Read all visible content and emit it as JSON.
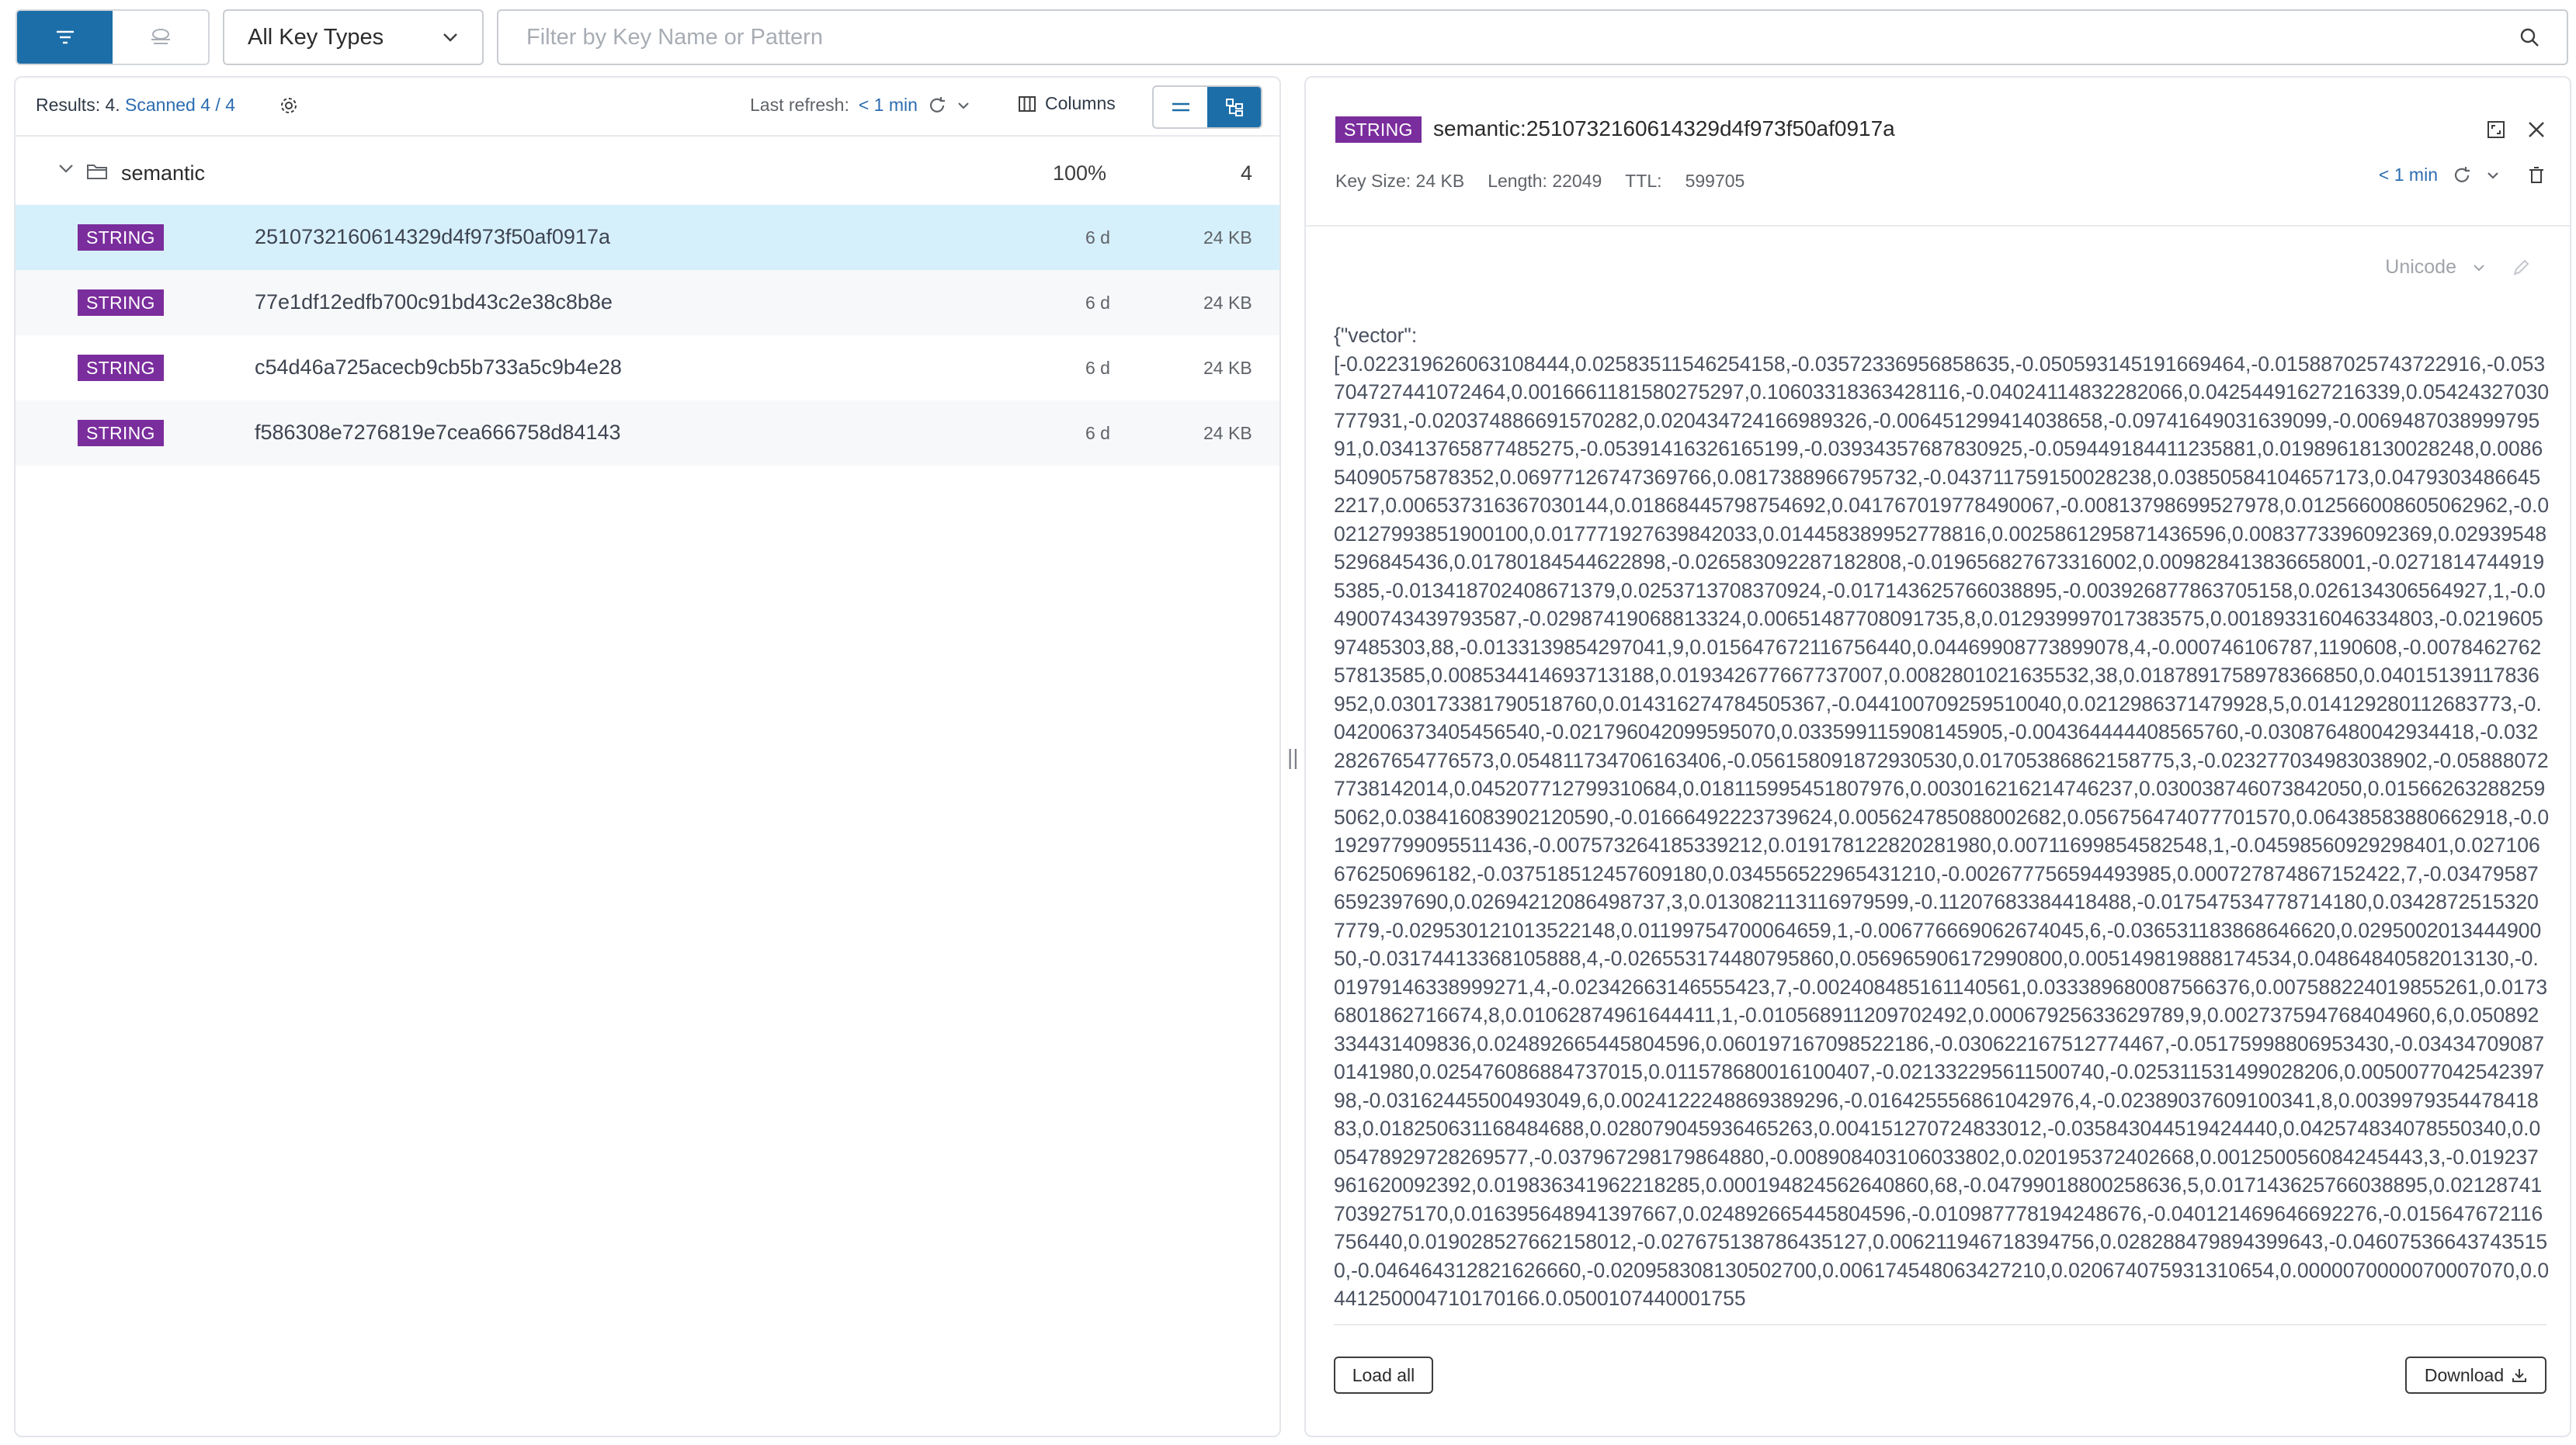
{
  "toolbar": {
    "key_type_select": "All Key Types",
    "filter_placeholder": "Filter by Key Name or Pattern"
  },
  "browser": {
    "results_label": "Results: 4.",
    "scanned_label": "Scanned 4 / 4",
    "last_refresh_label": "Last refresh:",
    "last_refresh_value": "< 1 min",
    "columns_label": "Columns"
  },
  "tree": {
    "folder": {
      "name": "semantic",
      "percent": "100%",
      "count": "4"
    },
    "keys": [
      {
        "type": "STRING",
        "name": "2510732160614329d4f973f50af0917a",
        "ttl": "6 d",
        "size": "24 KB"
      },
      {
        "type": "STRING",
        "name": "77e1df12edfb700c91bd43c2e38c8b8e",
        "ttl": "6 d",
        "size": "24 KB"
      },
      {
        "type": "STRING",
        "name": "c54d46a725acecb9cb5b733a5c9b4e28",
        "ttl": "6 d",
        "size": "24 KB"
      },
      {
        "type": "STRING",
        "name": "f586308e7276819e7cea666758d84143",
        "ttl": "6 d",
        "size": "24 KB"
      }
    ]
  },
  "details": {
    "type": "STRING",
    "key": "semantic:2510732160614329d4f973f50af0917a",
    "key_size": "Key Size: 24 KB",
    "length": "Length: 22049",
    "ttl_label": "TTL:",
    "ttl_value": "599705",
    "refresh_value": "< 1 min",
    "format": "Unicode",
    "value_header": "{\"vector\":",
    "value": "[-0.022319626063108444,0.02583511546254158,-0.03572336956858635,-0.050593145191669464,-0.015887025743722916,-0.053704727441072464,0.0016661181580275297,0.10603318363428116,-0.04024114832282066,0.04254491627216339,0.05424327030777931,-0.020374886691570282,0.020434724166989326,-0.006451299414038658,-0.09741649031639099,-0.006948703899979591,0.03413765877485275,-0.05391416326165199,-0.03934357687830925,-0.059449184411235881,0.01989618130028248,0.008654090575878352,0.06977126747369766,0.0817388966795732,-0.043711759150028238,0.03850584104657173,0.04793034866452217,0.006537316367030144,0.01868445798754692,0.041767019778490067,-0.00813798699527978,0.012566008605062962,-0.002127993851900100,0.017771927639842033,0.014458389952778816,0.0025861295871436596,0.0083773396092369,0.029395485296845436,0.01780184544622898,-0.026583092287182808,-0.019656827673316002,0.009828413836658001,-0.02718147449195385,-0.013418702408671379,0.0253713708370924,-0.017143625766038895,-0.003926877863705158,0.026134306564927,1,-0.04900743439793587,-0.02987419068813324,0.00651487708091735,8,0.012939997017383575,0.001893316046334803,-0.021960597485303,88,-0.0133139854297041,9,0.015647672116756440,0.04469908773899078,4,-0.000746106787,1190608,-0.007846276257813585,0.008534414693713188,0.019342677667737007,0.0082801021635532,38,0.0187891758978366850,0.04015139117836952,0.030173381790518760,0.014316274784505367,-0.044100709259510040,0.0212986371479928,5,0.014129280112683773,-0.042006373405456540,-0.021796042099595070,0.033599115908145905,-0.004364444408565760,-0.030876480042934418,-0.03228267654776573,0.054811734706163406,-0.056158091872930530,0.01705386862158775,3,-0.023277034983038902,-0.058880727738142014,0.045207712799310684,0.018115995451807976,0.003016216214746237,0.030038746073842050,0.015662632882595062,0.038416083902120590,-0.01666492223739624,0.005624785088002682,0.056756474077701570,0.06438583880662918,-0.019297799095511436,-0.007573264185339212,0.019178122820281980,0.00711699854582548,1,-0.04598560929298401,0.027106676250696182,-0.037518512457609180,0.034556522965431210,-0.002677756594493985,0.000727874867152422,7,-0.034795876592397690,0.02694212086498737,3,0.013082113116979599,-0.11207683384418488,-0.017547534778714180,0.03428725153207779,-0.029530121013522148,0.01199754700064659,1,-0.006776669062674045,6,-0.036531183868646620,0.029500201344490050,-0.03174413368105888,4,-0.026553174480795860,0.056965906172990800,0.005149819888174534,0.04864840582013130,-0.01979146338999271,4,-0.02342663146555423,7,-0.002408485161140561,0.033389680087566376,0.007588224019855261,0.01736801862716674,8,0.01062874961644411,1,-0.010568911209702492,0.00067925633629789,9,0.002737594768404960,6,0.050892334431409836,0.024892665445804596,0.060197167098522186,-0.030622167512774467,-0.05175998806953430,-0.034347090870141980,0.025476086884737015,0.011578680016100407,-0.021332295611500740,-0.025311531499028206,0.005007704254239798,-0.03162445500493049,6,0.0024122248869389296,-0.016425556861042976,4,-0.02389037609100341,8,0.003997935447841883,0.018250631168484688,0.028079045936465263,0.004151270724833012,-0.035843044519424440,0.042574834078550340,0.005478929728269577,-0.037967298179864880,-0.008908403106033802,0.020195372402668,0.001250056084245443,3,-0.019237961620092392,0.019836341962218285,0.000194824562640860,68,-0.04799018800258636,5,0.017143625766038895,0.021287417039275170,0.016395648941397667,0.024892665445804596,-0.010987778194248676,-0.040121469646692276,-0.015647672116756440,0.019028527662158012,-0.027675138786435127,0.006211946718394756,0.028288479894399643,-0.046075366437435150,-0.046464312821626660,-0.020958308130502700,0.006174548063427210,0.020674075931310654,0.0000070000070007070,0.0441250004710170166,0.0500107440001755"
  },
  "actions": {
    "load_all": "Load all",
    "download": "Download"
  }
}
